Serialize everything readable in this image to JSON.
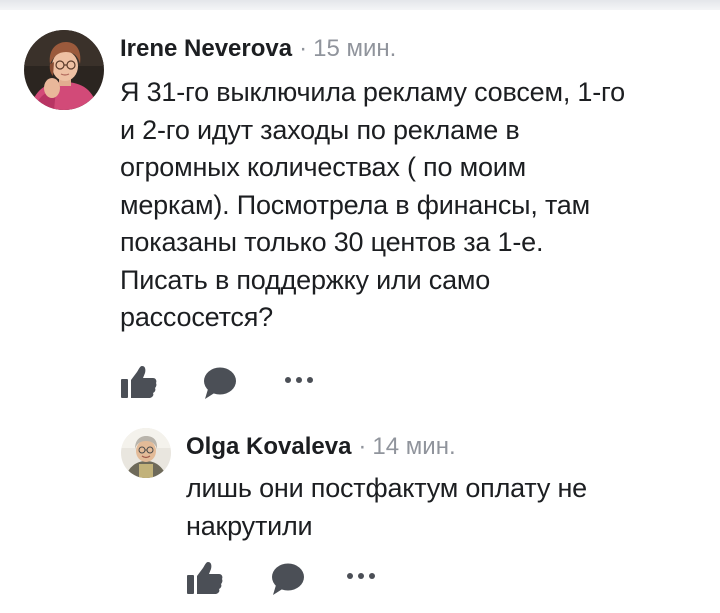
{
  "comments": [
    {
      "author": "Irene Neverova",
      "separator": "·",
      "time": "15 мин.",
      "lines": [
        "Я 31-го выключила рекламу совсем, 1-го",
        "и 2-го идут заходы по рекламе в",
        "огромных количествах ( по моим",
        "меркам). Посмотрела в финансы, там",
        "показаны только 30 центов за 1-е.",
        "Писать в поддержку или само",
        "рассосется?"
      ],
      "actions": {
        "like_icon": "thumbs-up-icon",
        "reply_icon": "speech-bubble-icon",
        "more_icon": "more-dots-icon"
      }
    },
    {
      "author": "Olga Kovaleva",
      "separator": "·",
      "time": "14 мин.",
      "lines": [
        "лишь они постфактум оплату не",
        "накрутили"
      ],
      "actions": {
        "like_icon": "thumbs-up-icon",
        "reply_icon": "speech-bubble-icon",
        "more_icon": "more-dots-icon"
      }
    }
  ],
  "colors": {
    "text": "#1c1e21",
    "meta": "#90949c",
    "icon": "#4b4f56"
  }
}
